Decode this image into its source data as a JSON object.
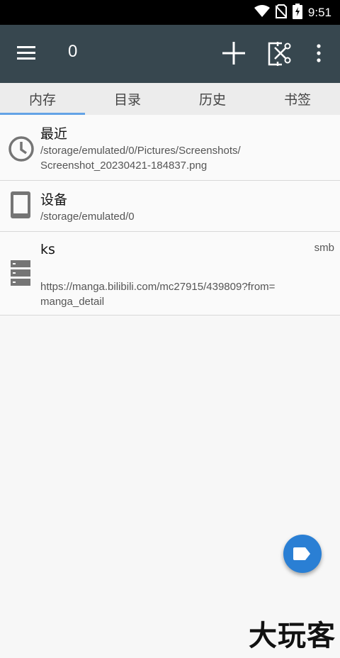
{
  "status_bar": {
    "time": "9:51",
    "icons": [
      "wifi-icon",
      "no-sim-icon",
      "battery-charging-icon"
    ]
  },
  "app_bar": {
    "title": "0",
    "icons": [
      "menu-icon",
      "add-icon",
      "cut-icon",
      "more-vert-icon"
    ],
    "background": "#37474f"
  },
  "tabs": [
    {
      "label": "内存",
      "active": true
    },
    {
      "label": "目录",
      "active": false
    },
    {
      "label": "历史",
      "active": false
    },
    {
      "label": "书签",
      "active": false
    }
  ],
  "list": [
    {
      "title": "最近",
      "path_line1": "/storage/emulated/0/Pictures/Screenshots/",
      "path_line2": "Screenshot_20230421-184837.png",
      "icon": "clock-icon"
    },
    {
      "title": "设备",
      "path_line1": "/storage/emulated/0",
      "icon": "phone-icon"
    },
    {
      "title": "ks",
      "path_line1": "https://manga.bilibili.com/mc27915/439809?from=",
      "path_line2": "manga_detail",
      "tag": "smb",
      "icon": "server-icon"
    }
  ],
  "fab": {
    "icon": "label-icon",
    "color": "#2a7fd4"
  },
  "watermark": "大玩客"
}
